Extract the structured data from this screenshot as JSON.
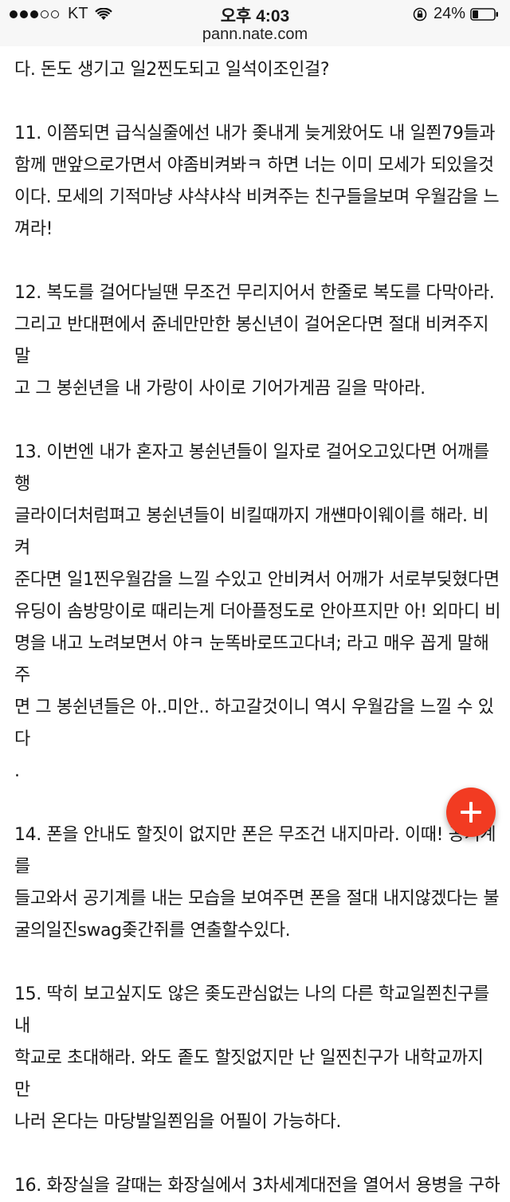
{
  "status_bar": {
    "carrier": "KT",
    "time": "오후 4:03",
    "battery": "24%",
    "signal_bars_on": 3,
    "signal_bars_total": 5
  },
  "browser": {
    "url": "pann.nate.com"
  },
  "article": {
    "lines": [
      "다. 돈도 생기고 일2찐도되고 일석이조인걸?",
      "",
      "11. 이쯤되면 급식실줄에선 내가 좆내게 늦게왔어도 내 일쬔79들과",
      "함께 맨앞으로가면서 야좀비켜봐ㅋ 하면 너는 이미 모세가 되있을것",
      "이다. 모세의 기적마냥 샤샥샤삭 비켜주는 친구들을보며 우월감을 느",
      "껴라!",
      "",
      "12. 복도를 걸어다닐땐 무조건 무리지어서 한줄로 복도를 다막아라.",
      "그리고 반대편에서 쥰네만만한 봉신년이 걸어온다면 절대 비켜주지말",
      "고 그 봉쉰년을 내 가랑이 사이로 기어가게끔 길을 막아라.",
      "",
      "13. 이번엔 내가 혼자고 봉쉰년들이 일자로 걸어오고있다면 어깨를 행",
      "글라이더처럼펴고 봉쉰년들이 비킬때까지 개썐마이웨이를 해라. 비켜",
      "준다면 일1찐우월감을 느낄 수있고 안비켜서 어깨가 서로부딪혔다면",
      "유딩이 솜방망이로 때리는게 더아플정도로 안아프지만 아! 외마디 비",
      "명을 내고 노려보면서 야ㅋ 눈똑바로뜨고다녀; 라고 매우 꼽게 말해주",
      "면 그 봉쉰년들은 아..미안.. 하고갈것이니 역시 우월감을 느낄 수 있다",
      ".",
      "",
      "14. 폰을 안내도 할짓이 없지만 폰은 무조건 내지마라. 이때! 공기계를",
      "들고와서 공기계를 내는 모습을 보여주면 폰을 절대 내지않겠다는 불",
      "굴의일진swag좆간쥐를 연출할수있다.",
      "",
      "15. 딱히 보고싶지도 않은 좆도관심없는 나의 다른 학교일쬔친구를 내",
      "학교로 초대해라. 와도 좉도 할짓없지만 난 일찐친구가 내학교까지 만",
      "나러 온다는 마당발일쬔임을 어필이 가능하다.",
      "",
      "16. 화장실을 갈때는 화장실에서 3차세계대전을 열어서 용병을 구하"
    ]
  },
  "fab": {
    "icon": "plus-icon",
    "color": "#f23b22"
  }
}
